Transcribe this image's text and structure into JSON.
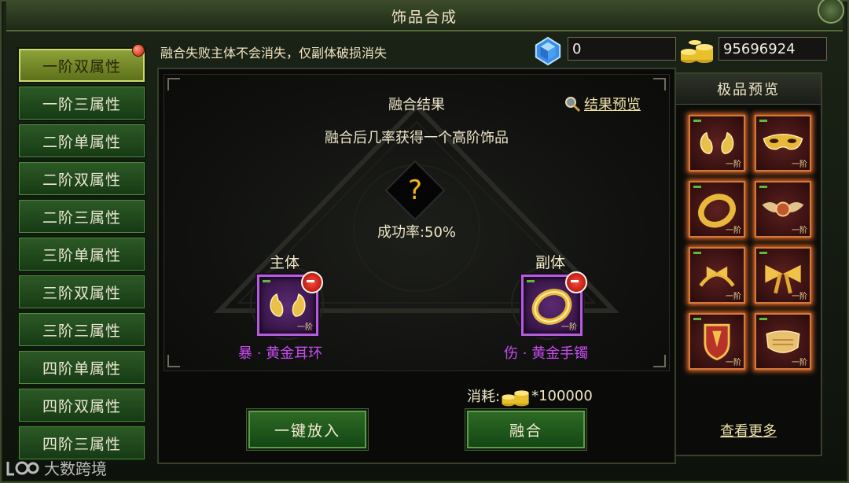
{
  "window": {
    "title": "饰品合成"
  },
  "tabs": [
    {
      "label": "一阶双属性",
      "active": true
    },
    {
      "label": "一阶三属性"
    },
    {
      "label": "二阶单属性"
    },
    {
      "label": "二阶双属性"
    },
    {
      "label": "二阶三属性"
    },
    {
      "label": "三阶单属性"
    },
    {
      "label": "三阶双属性"
    },
    {
      "label": "三阶三属性"
    },
    {
      "label": "四阶单属性"
    },
    {
      "label": "四阶双属性"
    },
    {
      "label": "四阶三属性"
    }
  ],
  "header": {
    "notice": "融合失败主体不会消失，仅副体破损消失",
    "diamond_value": "0",
    "gold_value": "95696924"
  },
  "fusion": {
    "result_title": "融合结果",
    "result_preview_link": "结果预览",
    "description": "融合后几率获得一个高阶饰品",
    "unknown_symbol": "?",
    "success_rate": "成功率:50%",
    "main_label": "主体",
    "sub_label": "副体",
    "main_item_name": "暴 · 黄金耳环",
    "sub_item_name": "伤 · 黄金手镯",
    "main_item_tier": "一阶",
    "sub_item_tier": "一阶",
    "cost_label": "消耗:",
    "cost_value": "*100000",
    "put_in_button": "一键放入",
    "fuse_button": "融合"
  },
  "preview": {
    "title": "极品预览",
    "items": [
      {
        "icon": "earring-icon",
        "tier": "一阶"
      },
      {
        "icon": "mask-icon",
        "tier": "一阶"
      },
      {
        "icon": "bracelet-icon",
        "tier": "一阶"
      },
      {
        "icon": "winged-emblem-icon",
        "tier": "一阶"
      },
      {
        "icon": "bow-headband-icon",
        "tier": "一阶"
      },
      {
        "icon": "bow-icon",
        "tier": "一阶"
      },
      {
        "icon": "shield-emblem-icon",
        "tier": "一阶"
      },
      {
        "icon": "face-mask-icon",
        "tier": "一阶"
      }
    ],
    "more_link": "查看更多"
  },
  "watermark": {
    "text": "大数跨境"
  },
  "colors": {
    "accent_green": "#2e6b25",
    "item_purple": "#c84bf0",
    "gold_text": "#f0e1a6"
  }
}
